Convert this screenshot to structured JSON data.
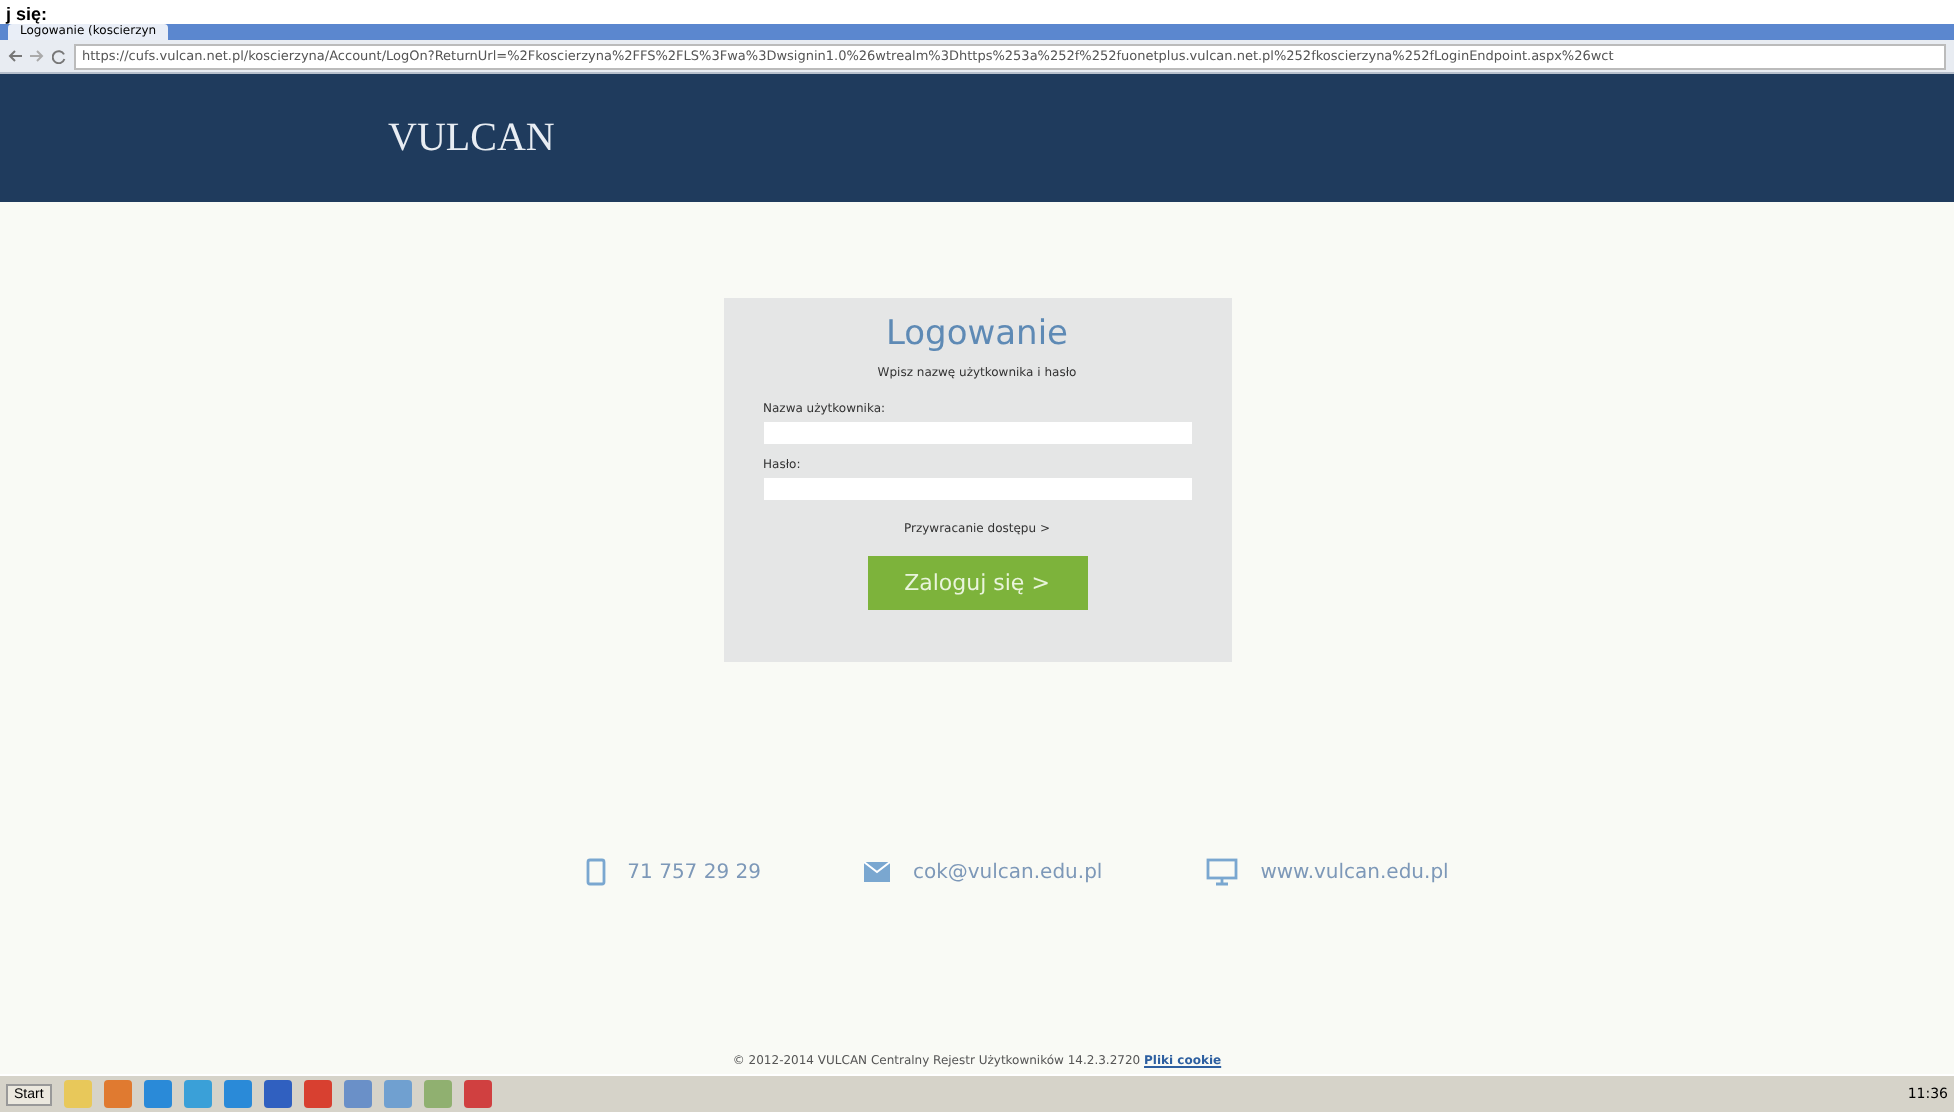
{
  "caption": "j się:",
  "browser": {
    "tab_title": "Logowanie (koscierzyn",
    "url": "https://cufs.vulcan.net.pl/koscierzyna/Account/LogOn?ReturnUrl=%2Fkoscierzyna%2FFS%2FLS%3Fwa%3Dwsignin1.0%26wtrealm%3Dhttps%253a%252f%252fuonetplus.vulcan.net.pl%252fkoscierzyna%252fLoginEndpoint.aspx%26wct"
  },
  "header": {
    "logo": "VULCAN"
  },
  "login": {
    "title": "Logowanie",
    "subtitle": "Wpisz nazwę użytkownika i hasło",
    "fields": [
      {
        "label": "Nazwa użytkownika:"
      },
      {
        "label": "Hasło:"
      }
    ],
    "recover_link": "Przywracanie dostępu >",
    "submit": "Zaloguj się >"
  },
  "contacts": [
    {
      "kind": "phone",
      "text": "71 757 29 29"
    },
    {
      "kind": "email",
      "text": "cok@vulcan.edu.pl"
    },
    {
      "kind": "web",
      "text": "www.vulcan.edu.pl"
    }
  ],
  "footer": {
    "text": "© 2012-2014 VULCAN Centralny Rejestr Użytkowników 14.2.3.2720",
    "link": "Pliki cookie"
  },
  "taskbar": {
    "start": "Start",
    "clock": "11:36"
  }
}
